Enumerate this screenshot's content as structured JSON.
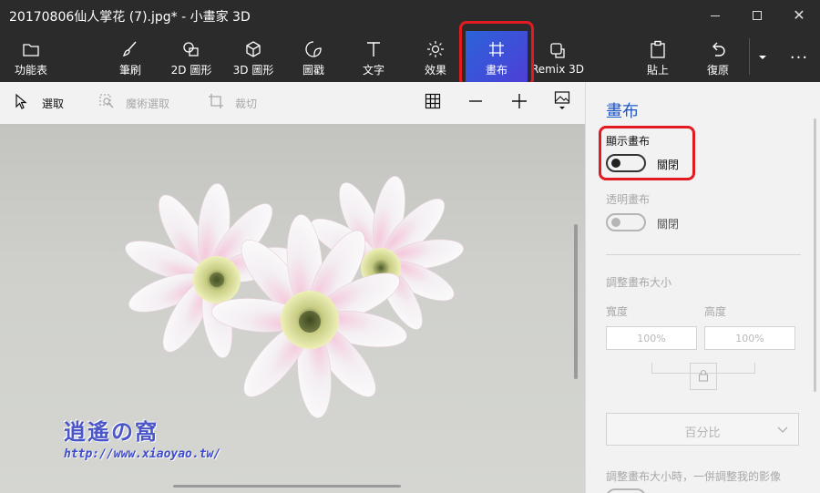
{
  "window": {
    "title": "20170806仙人掌花 (7).jpg* - 小畫家 3D"
  },
  "ribbon": {
    "menu": "功能表",
    "brushes": "筆刷",
    "shapes2d": "2D 圖形",
    "shapes3d": "3D 圖形",
    "stickers": "圖戳",
    "text": "文字",
    "effects": "效果",
    "canvas": "畫布",
    "remix": "Remix 3D",
    "paste": "貼上",
    "undo": "復原"
  },
  "toolbar": {
    "select": "選取",
    "magic_select": "魔術選取",
    "crop": "裁切"
  },
  "watermark": {
    "title": "逍遙の窩",
    "url": "http://www.xiaoyao.tw/"
  },
  "panel": {
    "title": "畫布",
    "show_canvas_label": "顯示畫布",
    "show_canvas_state": "關閉",
    "transparent_label": "透明畫布",
    "transparent_state": "關閉",
    "resize_label": "調整畫布大小",
    "width_label": "寬度",
    "height_label": "高度",
    "width_value": "100%",
    "height_value": "100%",
    "unit_select": "百分比",
    "resize_image_label": "調整畫布大小時，一併調整我的影像"
  },
  "colors": {
    "accent": "#1f56c6",
    "active_tab": "#3b52d8",
    "highlight": "#e21b23",
    "chrome": "#2b2b2b"
  }
}
